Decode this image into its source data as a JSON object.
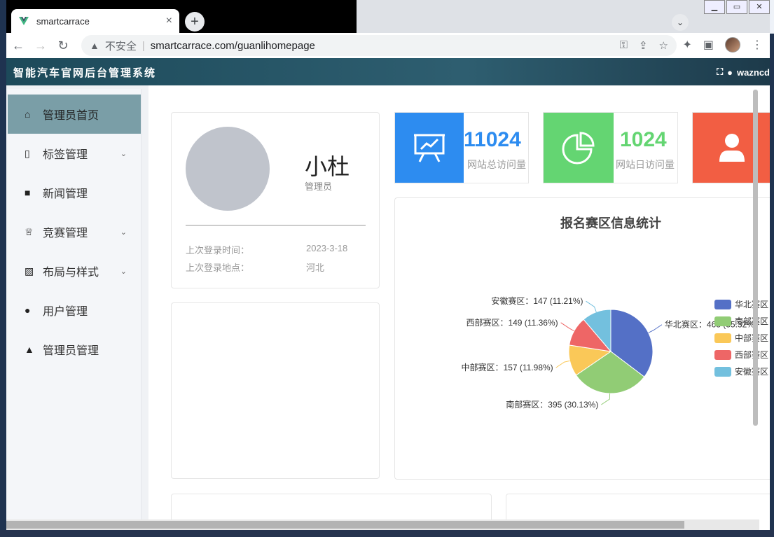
{
  "browser": {
    "tab_title": "smartcarrace",
    "tab_close": "×",
    "new_tab": "+",
    "security_label": "不安全",
    "url": "smartcarrace.com/guanlihomepage"
  },
  "app": {
    "title": "智能汽车官网后台管理系统",
    "username": "wazncd"
  },
  "sidebar": {
    "items": [
      {
        "label": "管理员首页",
        "icon": "home-icon",
        "active": true,
        "expandable": false
      },
      {
        "label": "标签管理",
        "icon": "bookmark-icon",
        "active": false,
        "expandable": true
      },
      {
        "label": "新闻管理",
        "icon": "video-camera-icon",
        "active": false,
        "expandable": false
      },
      {
        "label": "竞赛管理",
        "icon": "trophy-icon",
        "active": false,
        "expandable": true
      },
      {
        "label": "布局与样式",
        "icon": "image-icon",
        "active": false,
        "expandable": true
      },
      {
        "label": "用户管理",
        "icon": "user-icon",
        "active": false,
        "expandable": false
      },
      {
        "label": "管理员管理",
        "icon": "user-tie-icon",
        "active": false,
        "expandable": false
      }
    ]
  },
  "profile": {
    "name": "小杜",
    "role": "管理员",
    "last_login_time_label": "上次登录时间：",
    "last_login_time": "2023-3-18",
    "last_login_place_label": "上次登录地点：",
    "last_login_place": "河北"
  },
  "stats": [
    {
      "value": "11024",
      "label": "网站总访问量",
      "color": "#2d8cf0",
      "icon": "presentation-chart-icon"
    },
    {
      "value": "1024",
      "label": "网站日访问量",
      "color": "#64d572",
      "icon": "pie-chart-icon"
    },
    {
      "value": "",
      "label": "",
      "color": "#f25e43",
      "icon": "user-icon"
    }
  ],
  "chart_data": {
    "type": "pie",
    "title": "报名赛区信息统计",
    "categories": [
      "华北赛区",
      "南部赛区",
      "中部赛区",
      "西部赛区",
      "安徽赛区"
    ],
    "values": [
      463,
      395,
      157,
      149,
      147
    ],
    "percents": [
      "35.32%",
      "30.13%",
      "11.98%",
      "11.36%",
      "11.21%"
    ],
    "colors": [
      "#5470c6",
      "#91cc75",
      "#fac858",
      "#ee6666",
      "#73c0de"
    ],
    "legend": "right"
  }
}
